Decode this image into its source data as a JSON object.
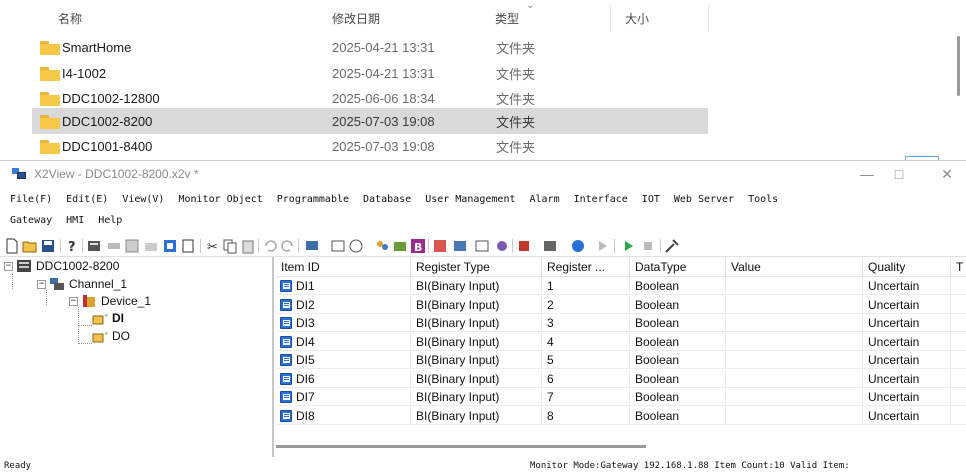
{
  "explorer": {
    "columns": {
      "name": "名称",
      "date": "修改日期",
      "type": "类型",
      "size": "大小"
    },
    "rows": [
      {
        "name": "SmartHome",
        "date": "2025-04-21 13:31",
        "type": "文件夹"
      },
      {
        "name": "I4-1002",
        "date": "2025-04-21 13:31",
        "type": "文件夹"
      },
      {
        "name": "DDC1002-12800",
        "date": "2025-06-06 18:34",
        "type": "文件夹"
      },
      {
        "name": "DDC1002-8200",
        "date": "2025-07-03 19:08",
        "type": "文件夹",
        "selected": true
      },
      {
        "name": "DDC1001-8400",
        "date": "2025-07-03 19:08",
        "type": "文件夹"
      }
    ]
  },
  "app": {
    "title": "X2View - DDC1002-8200.x2v *",
    "window_buttons": {
      "minimize": "—",
      "maximize": "□",
      "close": "✕"
    },
    "menu_row1": [
      "File(F)",
      "Edit(E)",
      "View(V)",
      "Monitor Object",
      "Programmable",
      "Database",
      "User Management",
      "Alarm",
      "Interface",
      "IOT",
      "Web Server",
      "Tools"
    ],
    "menu_row2": [
      "Gateway",
      "HMI",
      "Help"
    ],
    "tree": {
      "root": "DDC1002-8200",
      "channel": "Channel_1",
      "device": "Device_1",
      "group_di": "DI",
      "group_do": "DO"
    },
    "table": {
      "headers": [
        "Item ID",
        "Register Type",
        "Register ...",
        "DataType",
        "Value",
        "Quality",
        "T"
      ],
      "rows": [
        [
          "DI1",
          "BI(Binary Input)",
          "1",
          "Boolean",
          "",
          "Uncertain"
        ],
        [
          "DI2",
          "BI(Binary Input)",
          "2",
          "Boolean",
          "",
          "Uncertain"
        ],
        [
          "DI3",
          "BI(Binary Input)",
          "3",
          "Boolean",
          "",
          "Uncertain"
        ],
        [
          "DI4",
          "BI(Binary Input)",
          "4",
          "Boolean",
          "",
          "Uncertain"
        ],
        [
          "DI5",
          "BI(Binary Input)",
          "5",
          "Boolean",
          "",
          "Uncertain"
        ],
        [
          "DI6",
          "BI(Binary Input)",
          "6",
          "Boolean",
          "",
          "Uncertain"
        ],
        [
          "DI7",
          "BI(Binary Input)",
          "7",
          "Boolean",
          "",
          "Uncertain"
        ],
        [
          "DI8",
          "BI(Binary Input)",
          "8",
          "Boolean",
          "",
          "Uncertain"
        ]
      ]
    },
    "status": {
      "left": "Ready",
      "right": "Monitor Mode:Gateway 192.168.1.88 Item Count:10 Valid Item:"
    },
    "colors": {
      "folder": "#f6c848",
      "selection": "#d9d9d9",
      "di_icon": "#2c6fd6"
    }
  }
}
